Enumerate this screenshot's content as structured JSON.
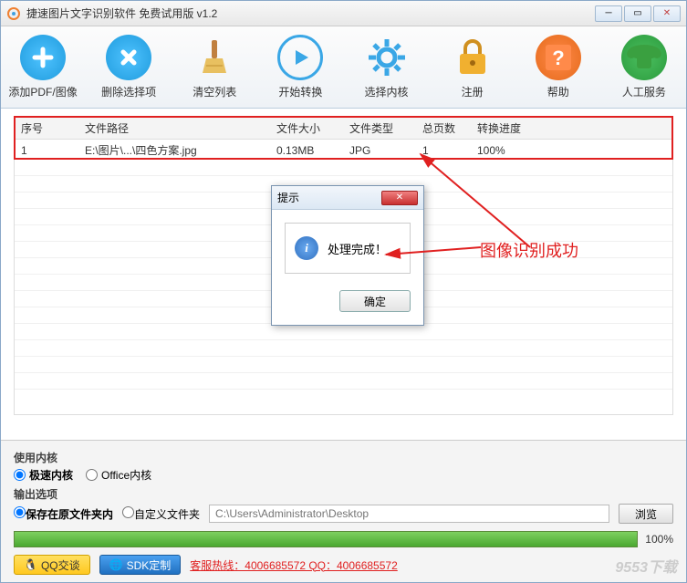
{
  "window": {
    "title": "捷速图片文字识别软件 免费试用版 v1.2"
  },
  "toolbar": {
    "add": "添加PDF/图像",
    "delete": "删除选择项",
    "clear": "清空列表",
    "start": "开始转换",
    "kernel": "选择内核",
    "register": "注册",
    "help": "帮助",
    "manual": "人工服务"
  },
  "table": {
    "headers": {
      "seq": "序号",
      "path": "文件路径",
      "size": "文件大小",
      "type": "文件类型",
      "pages": "总页数",
      "progress": "转换进度"
    },
    "rows": [
      {
        "seq": "1",
        "path": "E:\\图片\\...\\四色方案.jpg",
        "size": "0.13MB",
        "type": "JPG",
        "pages": "1",
        "progress": "100%"
      }
    ]
  },
  "dialog": {
    "title": "提示",
    "message": "处理完成！",
    "ok": "确定"
  },
  "annotation": {
    "success": "图像识别成功"
  },
  "options": {
    "kernel_label": "使用内核",
    "kernel_fast": "极速内核",
    "kernel_office": "Office内核",
    "output_label": "输出选项",
    "output_keep": "保存在原文件夹内",
    "output_custom": "自定义文件夹",
    "path_placeholder": "C:\\Users\\Administrator\\Desktop",
    "browse": "浏览"
  },
  "progress": {
    "percent": "100%",
    "value": 100
  },
  "footer": {
    "qq_chat": "QQ交谈",
    "sdk": "SDK定制",
    "hotline": "客服热线：4006685572 QQ：4006685572",
    "watermark": "9553下载"
  }
}
